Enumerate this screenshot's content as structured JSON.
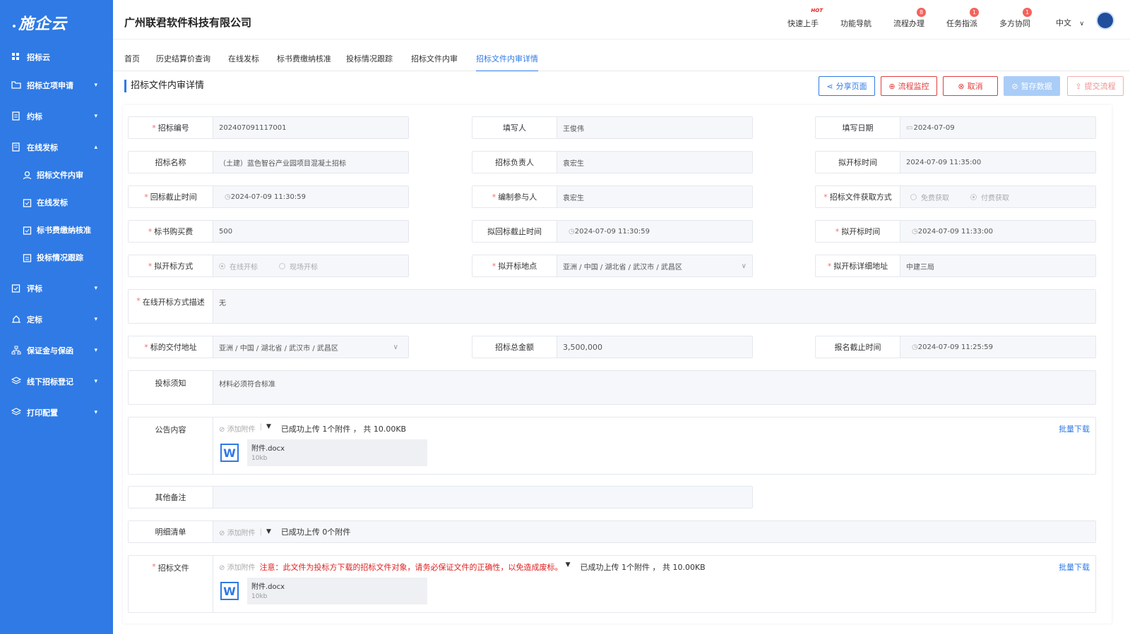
{
  "sidebar": {
    "logo": "施企云",
    "items": [
      {
        "label": "招标云"
      },
      {
        "label": "招标立项申请"
      },
      {
        "label": "约标"
      },
      {
        "label": "在线发标"
      },
      {
        "label": "招标文件内审"
      },
      {
        "label": "在线发标"
      },
      {
        "label": "标书费缴纳核准"
      },
      {
        "label": "投标情况跟踪"
      },
      {
        "label": "评标"
      },
      {
        "label": "定标"
      },
      {
        "label": "保证金与保函"
      },
      {
        "label": "线下招标登记"
      },
      {
        "label": "打印配置"
      }
    ]
  },
  "header": {
    "company": "广州联君软件科技有限公司",
    "quick_start": "快速上手",
    "hot": "HOT",
    "func_nav": "功能导航",
    "flow": "流程办理",
    "flow_badge": "8",
    "task": "任务指派",
    "task_badge": "1",
    "collab": "多方协同",
    "collab_badge": "1",
    "lang": "中文"
  },
  "tabs": [
    "首页",
    "历史结算价查询",
    "在线发标",
    "标书费缴纳核准",
    "投标情况跟踪",
    "招标文件内审",
    "招标文件内审详情"
  ],
  "page": {
    "title": "招标文件内审详情",
    "buttons": {
      "share": "分享页面",
      "monitor": "流程监控",
      "cancel": "取消",
      "save": "暂存数据",
      "submit": "提交流程"
    }
  },
  "form": {
    "bid_no": {
      "label": "招标编号",
      "value": "202407091117001"
    },
    "writer": {
      "label": "填写人",
      "value": "王俊伟"
    },
    "write_date": {
      "label": "填写日期",
      "value": "2024-07-09"
    },
    "bid_name": {
      "label": "招标名称",
      "value": "（土建）蓝色智谷产业园项目混凝土招标"
    },
    "bid_owner": {
      "label": "招标负责人",
      "value": "袁宏生"
    },
    "plan_open_time": {
      "label": "拟开标时间",
      "value": "2024-07-09 11:35:00"
    },
    "return_deadline": {
      "label": "回标截止时间",
      "value": "2024-07-09 11:30:59"
    },
    "editors": {
      "label": "编制参与人",
      "value": "袁宏生"
    },
    "file_get": {
      "label": "招标文件获取方式",
      "opt1": "免费获取",
      "opt2": "付费获取"
    },
    "fee": {
      "label": "标书购买费",
      "value": "500"
    },
    "plan_return_deadline": {
      "label": "拟回标截止时间",
      "value": "2024-07-09 11:30:59"
    },
    "plan_open_time2": {
      "label": "拟开标时间",
      "value": "2024-07-09 11:33:00"
    },
    "open_method": {
      "label": "拟开标方式",
      "opt1": "在线开标",
      "opt2": "现场开标"
    },
    "open_place": {
      "label": "拟开标地点",
      "value": "亚洲 / 中国 / 湖北省 / 武汉市 / 武昌区"
    },
    "open_address": {
      "label": "拟开标详细地址",
      "value": "中建三局"
    },
    "online_desc": {
      "label": "在线开标方式描述",
      "value": "无"
    },
    "delivery": {
      "label": "标的交付地址",
      "value": "亚洲 / 中国 / 湖北省 / 武汉市 / 武昌区"
    },
    "total": {
      "label": "招标总金额",
      "value": "3,500,000"
    },
    "signup_deadline": {
      "label": "报名截止时间",
      "value": "2024-07-09 11:25:59"
    },
    "notice": {
      "label": "投标须知",
      "value": "材料必须符合标准"
    },
    "announce": {
      "label": "公告内容",
      "add": "添加附件",
      "info": "已成功上传 1个附件 ， 共 10.00KB",
      "batch": "批量下载",
      "file": "附件.docx",
      "size": "10kb"
    },
    "remark": {
      "label": "其他备注",
      "value": ""
    },
    "detail": {
      "label": "明细清单",
      "add": "添加附件",
      "info": "已成功上传 0个附件"
    },
    "bidfile": {
      "label": "招标文件",
      "add": "添加附件",
      "warn": "注意：此文件为投标方下载的招标文件对象，请务必保证文件的正确性，以免造成废标。",
      "info": "已成功上传 1个附件 ， 共 10.00KB",
      "batch": "批量下载",
      "file": "附件.docx",
      "size": "10kb"
    }
  }
}
